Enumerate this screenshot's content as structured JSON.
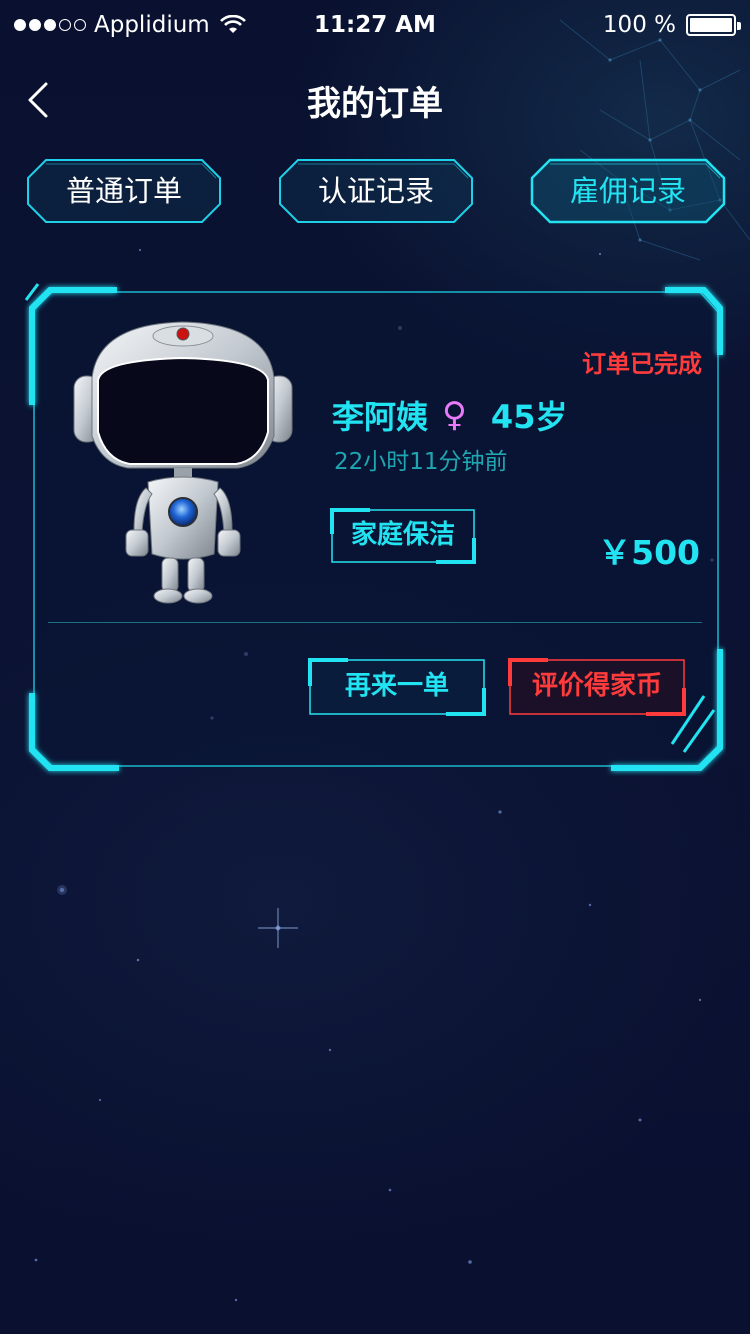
{
  "status_bar": {
    "carrier": "Applidium",
    "time": "11:27 AM",
    "battery": "100 %",
    "signal_bars_filled": 3,
    "signal_bars_total": 5
  },
  "nav": {
    "title": "我的订单",
    "back_icon": "chevron-left-icon"
  },
  "tabs": [
    {
      "label": "普通订单",
      "active": false
    },
    {
      "label": "认证记录",
      "active": false
    },
    {
      "label": "雇佣记录",
      "active": true
    }
  ],
  "order": {
    "status": "订单已完成",
    "name": "李阿姨",
    "gender_symbol": "♀",
    "age": "45岁",
    "time_ago": "22小时11分钟前",
    "service": "家庭保洁",
    "price": "￥500",
    "actions": {
      "reorder": "再来一单",
      "review": "评价得家币"
    }
  },
  "colors": {
    "accent": "#22e3f2",
    "alert": "#ff3b3b",
    "gender": "#e879f9",
    "background": "#0b1233"
  }
}
